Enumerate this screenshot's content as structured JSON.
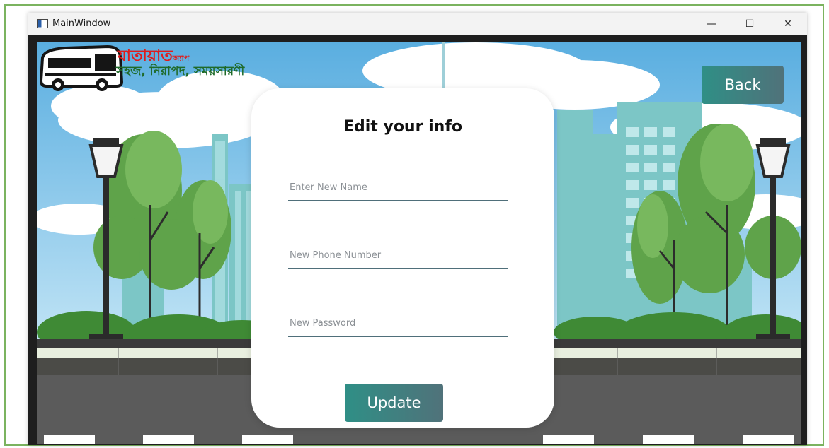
{
  "window": {
    "title": "MainWindow",
    "minimize_glyph": "—",
    "maximize_glyph": "☐",
    "close_glyph": "✕"
  },
  "logo": {
    "brand": "যাতায়াত",
    "brand_suffix": "অ্যাপ",
    "tagline": "সহজ, নিরাপদ, সময়সারণী",
    "icon": "bus-icon"
  },
  "header": {
    "back_label": "Back"
  },
  "form": {
    "title": "Edit your info",
    "name_placeholder": "Enter New Name",
    "phone_placeholder": "New Phone Number",
    "password_placeholder": "New Password",
    "update_label": "Update"
  },
  "colors": {
    "accent_start": "#2f8f86",
    "accent_end": "#50727a",
    "brand_red": "#e01b1b",
    "brand_green": "#1f6b2a",
    "frame_green": "#7bb35f"
  }
}
